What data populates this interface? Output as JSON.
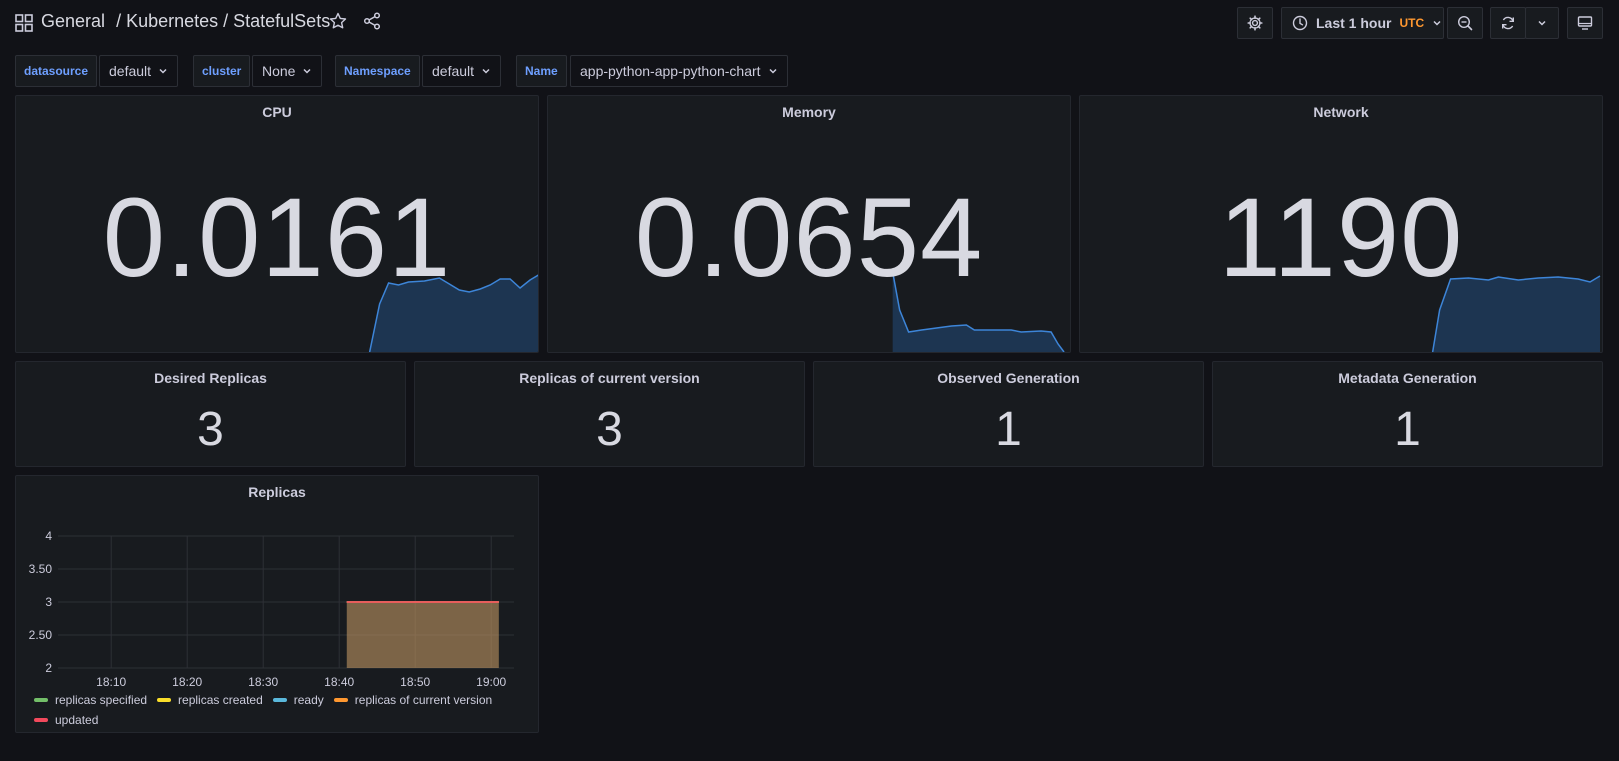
{
  "breadcrumb": {
    "folder": "General",
    "path": "/ Kubernetes / StatefulSets"
  },
  "time_picker": {
    "range": "Last 1 hour",
    "timezone": "UTC"
  },
  "variables": [
    {
      "label": "datasource",
      "value": "default"
    },
    {
      "label": "cluster",
      "value": "None"
    },
    {
      "label": "Namespace",
      "value": "default"
    },
    {
      "label": "Name",
      "value": "app-python-app-python-chart"
    }
  ],
  "stat_panels": [
    {
      "title": "CPU",
      "value": "0.0161"
    },
    {
      "title": "Memory",
      "value": "0.0654"
    },
    {
      "title": "Network",
      "value": "1190"
    }
  ],
  "small_stats": [
    {
      "title": "Desired Replicas",
      "value": "3"
    },
    {
      "title": "Replicas of current version",
      "value": "3"
    },
    {
      "title": "Observed Generation",
      "value": "1"
    },
    {
      "title": "Metadata Generation",
      "value": "1"
    }
  ],
  "colors": {
    "background": "#111217",
    "panel": "#181b1f",
    "accent_blue": "#5794f2",
    "variable_label": "#6e9fff",
    "utc_orange": "#ff9830"
  },
  "chart_data": {
    "type": "area",
    "title": "Replicas",
    "x_ticks": [
      "18:10",
      "18:20",
      "18:30",
      "18:40",
      "18:50",
      "19:00"
    ],
    "y_ticks": [
      "2",
      "2.50",
      "3",
      "3.50",
      "4"
    ],
    "ylim": [
      2,
      4
    ],
    "grid": true,
    "legend_placement": "bottom",
    "series": [
      {
        "name": "replicas specified",
        "color": "#73bf69",
        "values": [
          3,
          3
        ]
      },
      {
        "name": "replicas created",
        "color": "#fade2a",
        "values": [
          3,
          3
        ]
      },
      {
        "name": "ready",
        "color": "#5ab8db",
        "values": [
          3,
          3
        ]
      },
      {
        "name": "replicas of current version",
        "color": "#ff9830",
        "values": [
          3,
          3
        ]
      },
      {
        "name": "updated",
        "color": "#f2495c",
        "values": [
          3,
          3
        ]
      }
    ],
    "x": [
      "18:41",
      "19:01"
    ]
  }
}
